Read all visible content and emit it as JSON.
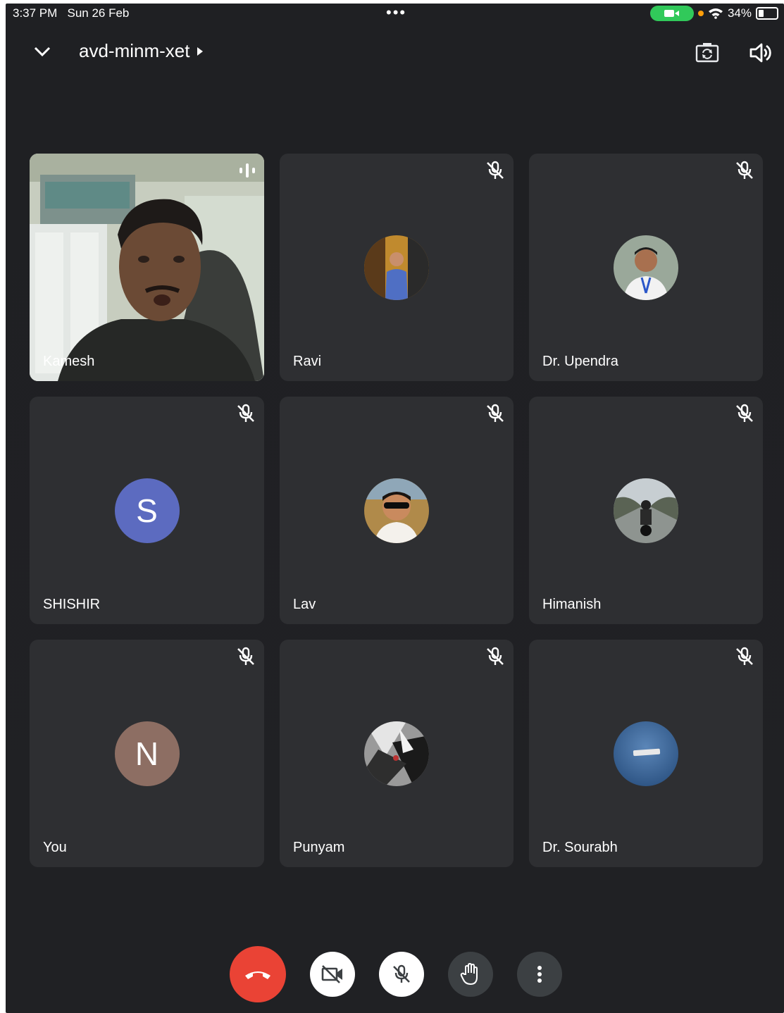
{
  "status": {
    "time": "3:37 PM",
    "date": "Sun 26 Feb",
    "dots": "•••",
    "battery": "34%",
    "battery_level": 0.34
  },
  "header": {
    "meeting_code": "avd-minm-xet"
  },
  "participants": [
    {
      "name": "Kamesh",
      "type": "video",
      "muted": false
    },
    {
      "name": "Ravi",
      "type": "photo",
      "muted": true
    },
    {
      "name": "Dr. Upendra",
      "type": "photo",
      "muted": true
    },
    {
      "name": "SHISHIR",
      "type": "initial",
      "initial": "S",
      "color": "#5c6bc0",
      "muted": true
    },
    {
      "name": "Lav",
      "type": "photo",
      "muted": true
    },
    {
      "name": "Himanish",
      "type": "photo",
      "muted": true
    },
    {
      "name": "You",
      "type": "initial",
      "initial": "N",
      "color": "#8d6e63",
      "muted": true
    },
    {
      "name": "Punyam",
      "type": "photo",
      "muted": true
    },
    {
      "name": "Dr. Sourabh",
      "type": "photo",
      "muted": true
    }
  ],
  "colors": {
    "leave": "#ea4335",
    "tile": "#2e2f32",
    "background": "#202124"
  }
}
